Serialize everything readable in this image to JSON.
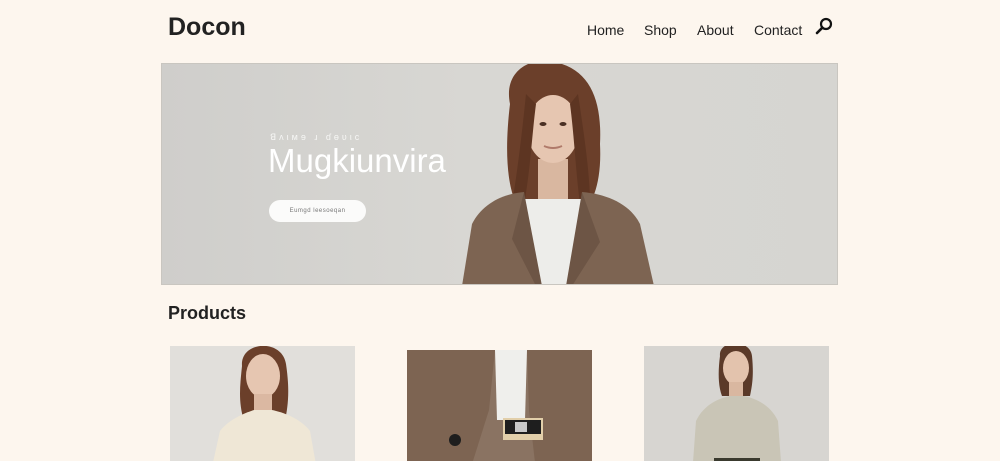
{
  "brand": {
    "logo": "Docon"
  },
  "nav": {
    "items": [
      "Home",
      "Shop",
      "About",
      "Contact"
    ],
    "search_icon": "search-icon"
  },
  "hero": {
    "kicker": "ꓭʌιмɘ ɹ ɗɵʋιc",
    "title": "Mugkiunvira",
    "button_label": "Eumgd leesoeqan"
  },
  "products": {
    "title": "Products",
    "items": [
      {
        "image": "woman-cream-tshirt"
      },
      {
        "image": "brown-blazer-closeup"
      },
      {
        "image": "woman-sage-blouse"
      }
    ]
  },
  "colors": {
    "background": "#fdf6ee",
    "text": "#222222",
    "hero_bg": "#d6d5d1",
    "blazer": "#7d6452"
  }
}
